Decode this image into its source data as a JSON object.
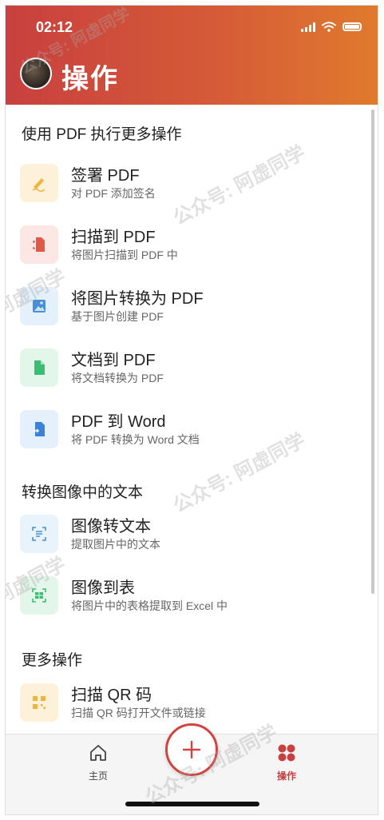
{
  "status": {
    "time": "02:12"
  },
  "header": {
    "title": "操作"
  },
  "sections": [
    {
      "title": "使用 PDF 执行更多操作",
      "items": [
        {
          "title": "签署 PDF",
          "subtitle": "对 PDF 添加签名",
          "icon": "signature-pen-icon",
          "tile_bg": "#fdf1da",
          "icon_color": "#f0b43c"
        },
        {
          "title": "扫描到 PDF",
          "subtitle": "将图片扫描到 PDF 中",
          "icon": "scan-document-icon",
          "tile_bg": "#fde7e4",
          "icon_color": "#e05a45"
        },
        {
          "title": "将图片转换为 PDF",
          "subtitle": "基于图片创建 PDF",
          "icon": "image-file-icon",
          "tile_bg": "#e4f0fb",
          "icon_color": "#4a8fd6"
        },
        {
          "title": "文档到 PDF",
          "subtitle": "将文档转换为 PDF",
          "icon": "document-file-icon",
          "tile_bg": "#e2f6ea",
          "icon_color": "#3cbd74"
        },
        {
          "title": "PDF 到 Word",
          "subtitle": "将 PDF 转换为 Word 文档",
          "icon": "word-file-icon",
          "tile_bg": "#e4f0fb",
          "icon_color": "#3d82d9"
        }
      ]
    },
    {
      "title": "转换图像中的文本",
      "items": [
        {
          "title": "图像转文本",
          "subtitle": "提取图片中的文本",
          "icon": "text-scan-icon",
          "tile_bg": "#e8f3fc",
          "icon_color": "#4a8fd6"
        },
        {
          "title": "图像到表",
          "subtitle": "将图片中的表格提取到 Excel 中",
          "icon": "table-scan-icon",
          "tile_bg": "#e3f6ea",
          "icon_color": "#3cbd74"
        }
      ]
    },
    {
      "title": "更多操作",
      "items": [
        {
          "title": "扫描 QR 码",
          "subtitle": "扫描 QR 码打开文件或链接",
          "icon": "qr-code-icon",
          "tile_bg": "#fdf1da",
          "icon_color": "#f0b43c"
        }
      ]
    }
  ],
  "tabbar": {
    "home_label": "主页",
    "actions_label": "操作",
    "accent_color": "#c8403f"
  },
  "watermark": "公众号: 阿虚同学"
}
